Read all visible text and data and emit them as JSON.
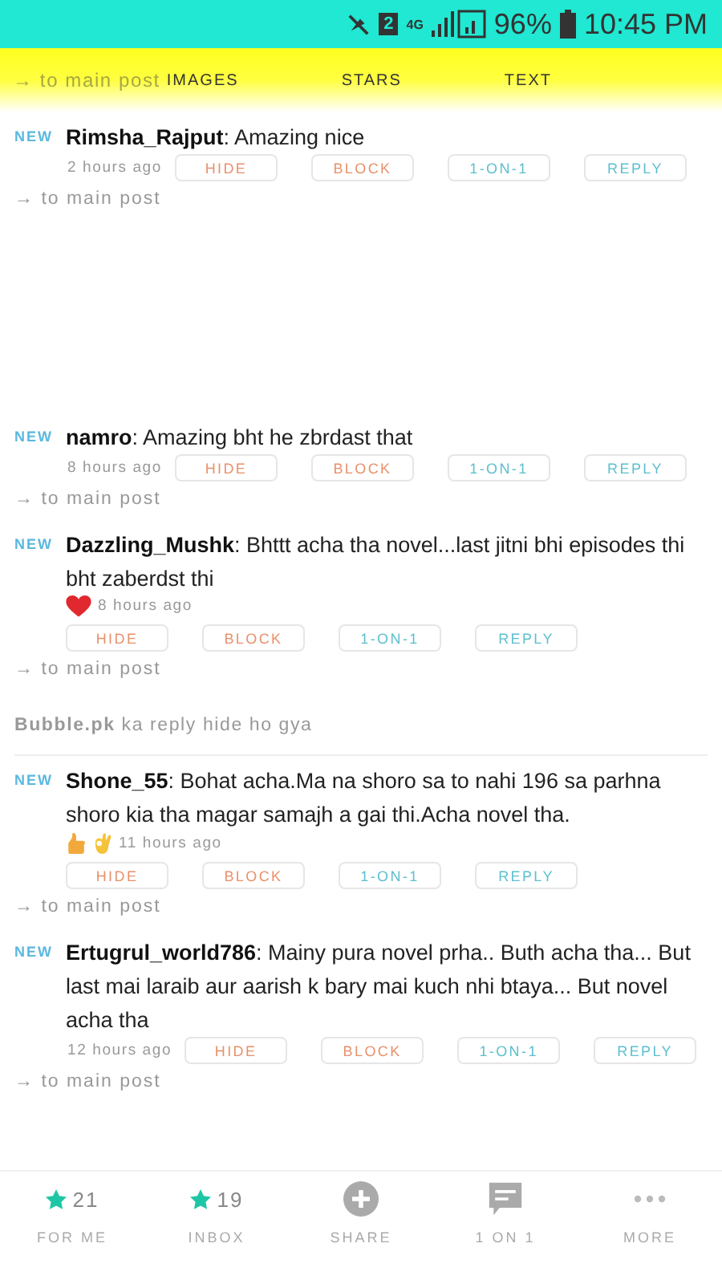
{
  "status_bar": {
    "sim": "2",
    "network": "4G",
    "battery": "96%",
    "time": "10:45 PM"
  },
  "header": {
    "faded_link": "→ to main post",
    "tabs": [
      "IMAGES",
      "STARS",
      "TEXT"
    ]
  },
  "feed": [
    {
      "kind": "comment",
      "badge": "NEW",
      "text": "**Rimsha_Rajput**: Amazing nice",
      "time": "2 hours ago",
      "buttons": [
        "HIDE",
        "BLOCK",
        "1-ON-1",
        "REPLY"
      ],
      "link": "→ to main post"
    },
    {
      "kind": "blank"
    },
    {
      "kind": "comment",
      "badge": "NEW",
      "text": "**namro**: Amazing bht he zbrdast that",
      "time": "8 hours ago",
      "buttons": [
        "HIDE",
        "BLOCK",
        "1-ON-1",
        "REPLY"
      ],
      "link": "→ to main post"
    },
    {
      "kind": "comment",
      "badge": "NEW",
      "text": "**Dazzling_Mushk**: Bhttt acha tha novel...last jitni bhi episodes thi bht zaberdst thi",
      "emojis": [
        {
          "kind": "heart"
        }
      ],
      "time": "8 hours ago",
      "buttons": [
        "HIDE",
        "BLOCK",
        "1-ON-1",
        "REPLY"
      ],
      "link": "→ to main post"
    },
    {
      "kind": "notice",
      "text": "**Bubble.pk** ka reply hide ho gya"
    },
    {
      "kind": "comment",
      "badge": "NEW",
      "text": "**Shone_55**: Bohat acha.Ma na shoro sa to nahi 196 sa parhna shoro kia tha magar samajh a gai thi.Acha novel tha.",
      "emojis": [
        {
          "kind": "thumb"
        },
        {
          "kind": "ok"
        }
      ],
      "time": "11 hours ago",
      "buttons": [
        "HIDE",
        "BLOCK",
        "1-ON-1",
        "REPLY"
      ],
      "link": "→ to main post"
    },
    {
      "kind": "comment",
      "badge": "NEW",
      "text": "**Ertugrul_world786**: Mainy pura novel prha.. Buth acha tha... But last mai laraib aur aarish k bary mai kuch nhi btaya... But novel acha tha",
      "time": "12 hours ago",
      "buttons": [
        "HIDE",
        "BLOCK",
        "1-ON-1",
        "REPLY"
      ],
      "link": "→ to main post"
    }
  ],
  "bottom_nav": [
    {
      "kind": "star",
      "count": "21",
      "label": "FOR ME"
    },
    {
      "kind": "star",
      "count": "19",
      "label": "INBOX"
    },
    {
      "kind": "plus",
      "label": "SHARE"
    },
    {
      "kind": "chat",
      "label": "1 ON 1"
    },
    {
      "kind": "more",
      "label": "MORE"
    }
  ]
}
